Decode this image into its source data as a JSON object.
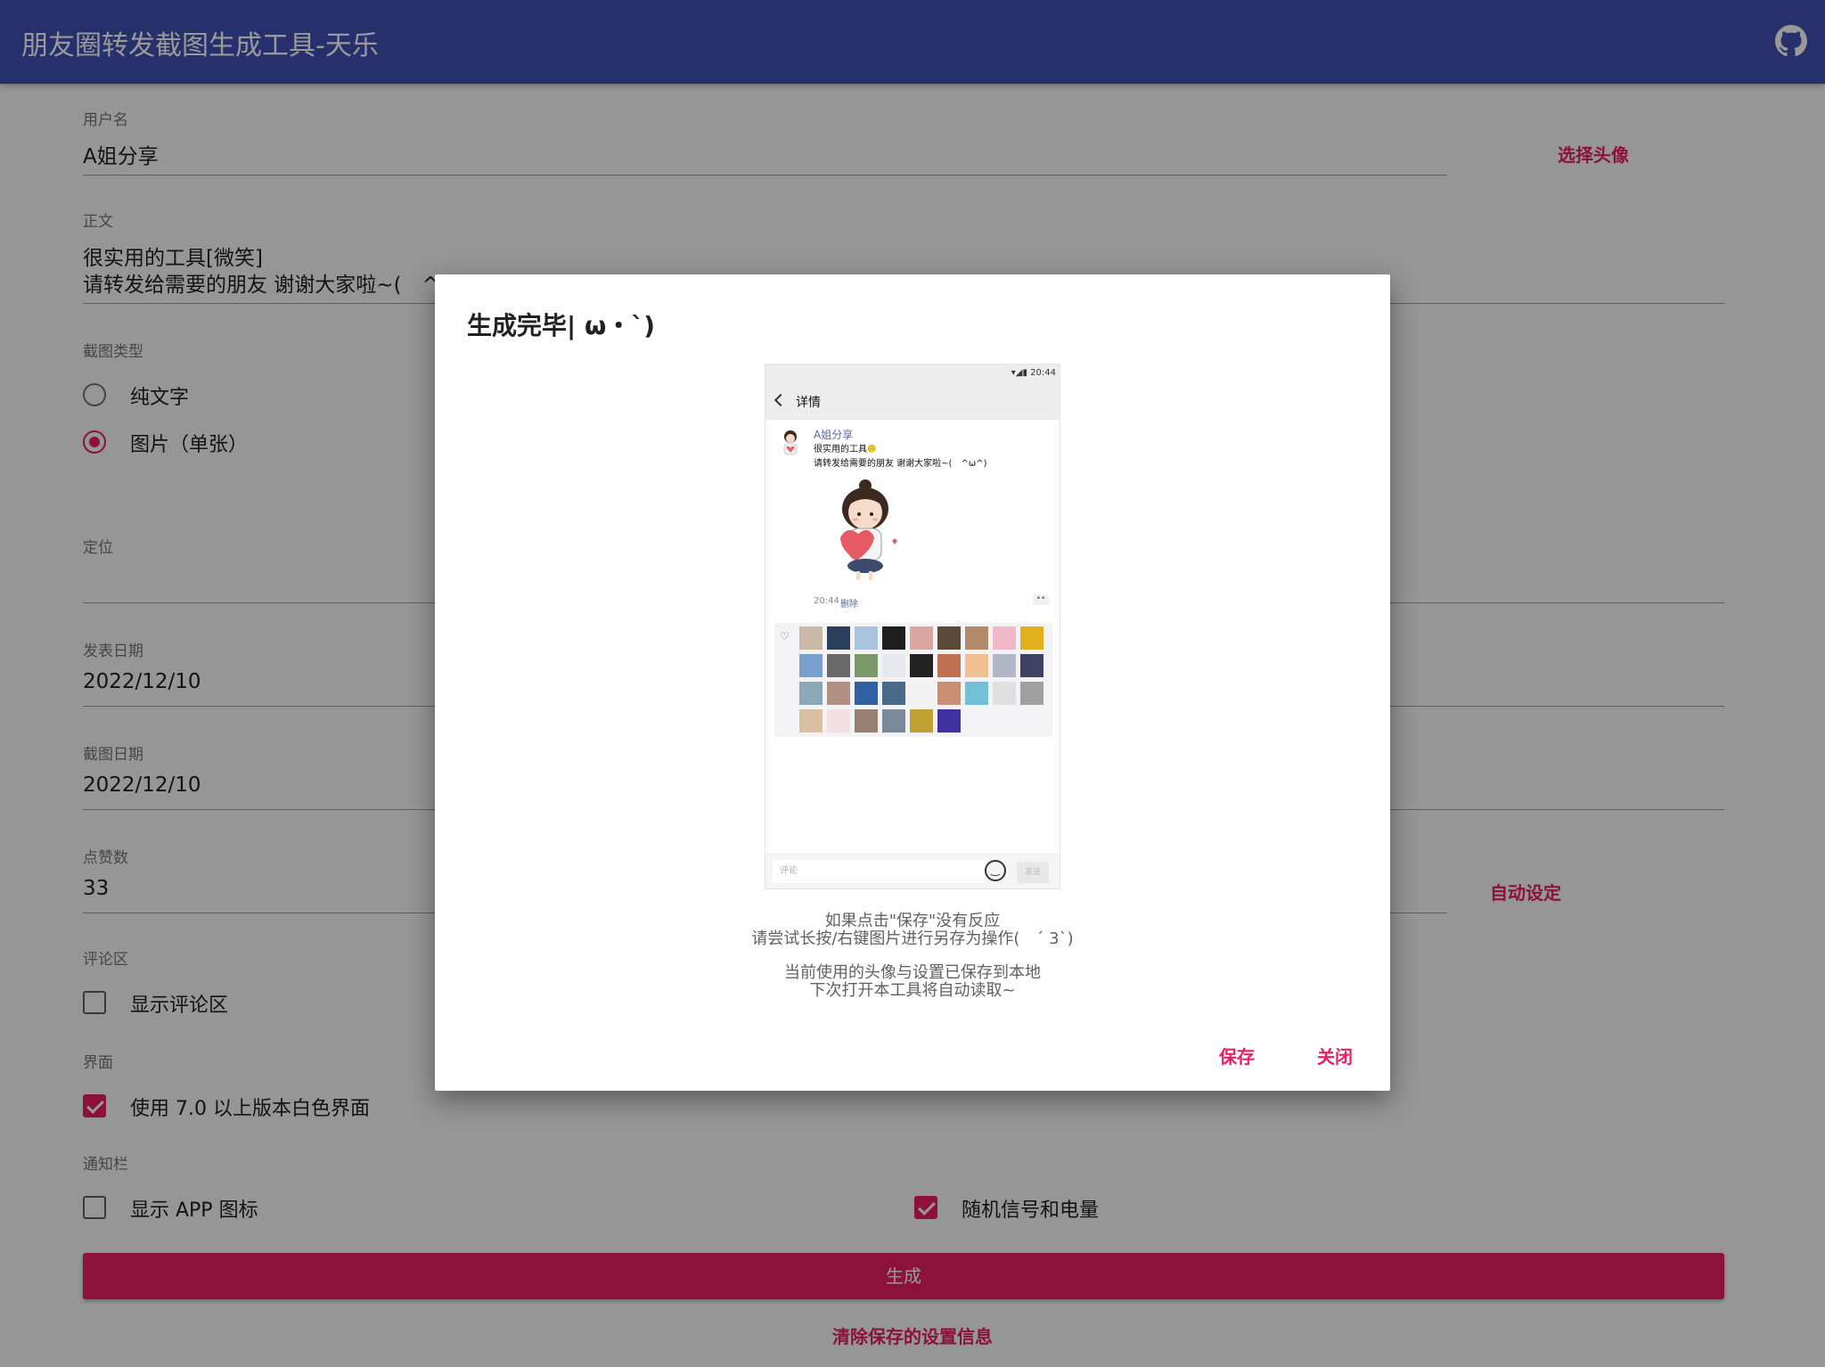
{
  "appbar": {
    "title": "朋友圈转发截图生成工具-天乐",
    "github_icon": "github-icon"
  },
  "form": {
    "username": {
      "label": "用户名",
      "value": "A姐分享",
      "action": "选择头像"
    },
    "body": {
      "label": "正文",
      "line1": "很实用的工具[微笑]",
      "line2": "请转发给需要的朋友 谢谢大家啦~(　^ω^)"
    },
    "type": {
      "label": "截图类型",
      "options": [
        "纯文字",
        "图片（单张）"
      ],
      "selected": "图片（单张）"
    },
    "location": {
      "label": "定位",
      "value": ""
    },
    "post_date": {
      "label": "发表日期",
      "value": "2022/12/10"
    },
    "shot_date": {
      "label": "截图日期",
      "value": "2022/12/10"
    },
    "likes": {
      "label": "点赞数",
      "value": "33",
      "action": "自动设定"
    },
    "comments": {
      "label": "评论区",
      "option": "显示评论区",
      "checked": false
    },
    "ui": {
      "label": "界面",
      "option": "使用 7.0 以上版本白色界面",
      "checked": true
    },
    "notification": {
      "label": "通知栏",
      "option1": "显示 APP 图标",
      "option1_checked": false,
      "option2": "随机信号和电量",
      "option2_checked": true
    },
    "generate_label": "生成",
    "clear_label": "清除保存的设置信息"
  },
  "dialog": {
    "title": "生成完毕| ω・`)",
    "preview": {
      "status_time": "20:44",
      "nav_title": "详情",
      "name": "A姐分享",
      "text1": "很实用的工具",
      "text2": "请转发给需要的朋友 谢谢大家啦~(　^ω^)",
      "time": "20:44",
      "delete": "删除",
      "comment_placeholder": "评论",
      "send": "发送",
      "avatar_count": 33
    },
    "msg1_line1": "如果点击\"保存\"没有反应",
    "msg1_line2": "请尝试长按/右键图片进行另存为操作(　´ 3`)",
    "msg2_line1": "当前使用的头像与设置已保存到本地",
    "msg2_line2": "下次打开本工具将自动读取~",
    "save": "保存",
    "close": "关闭"
  },
  "colors": {
    "primary": "#3f51b5",
    "accent": "#e91e63",
    "link_blue": "#576b95"
  }
}
